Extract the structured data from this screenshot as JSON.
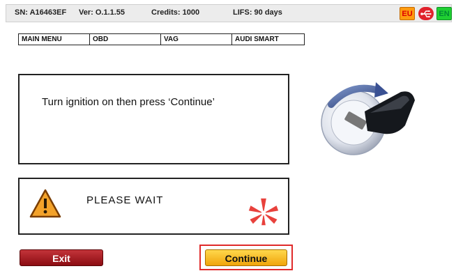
{
  "status_bar": {
    "sn": "SN: A16463EF",
    "ver": "Ver: O.1.1.55",
    "credits": "Credits: 1000",
    "lifs": "LIFS: 90 days",
    "flag_eu": "EU",
    "flag_en": "EN"
  },
  "breadcrumb": [
    "MAIN MENU",
    "OBD",
    "VAG",
    "AUDI SMART"
  ],
  "message": "Turn ignition on then press ‘Continue’",
  "wait": {
    "text": "PLEASE WAIT",
    "icon": "warning-icon",
    "spinner_icon": "spinner-icon"
  },
  "ignition_icon": "ignition-key-icon",
  "buttons": {
    "exit": "Exit",
    "continue": "Continue"
  },
  "colors": {
    "exit": "#a01c22",
    "continue": "#f5b623",
    "highlight": "#e02a2a",
    "spinner": "#e8413c"
  }
}
